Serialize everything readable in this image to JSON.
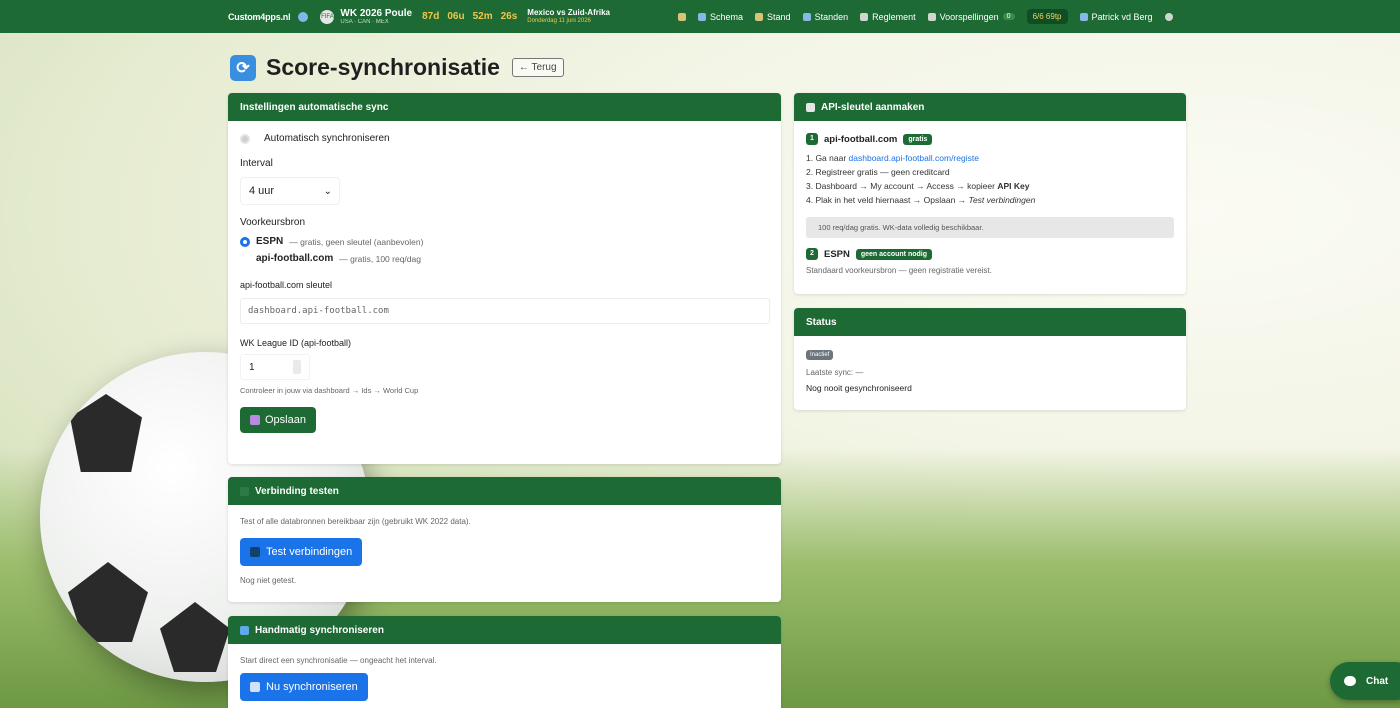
{
  "topbar": {
    "brand": "Custom4pps.nl",
    "poule_title": "WK 2026 Poule",
    "poule_sub": "USA · CAN · MEX",
    "poule_badge": "FIFA",
    "countdown": [
      "87d",
      "06u",
      "52m",
      "26s"
    ],
    "match_title": "Mexico vs Zuid-Afrika",
    "match_sub": "Donderdag 11 juni 2026",
    "nav": [
      {
        "label": "Schema"
      },
      {
        "label": "Stand"
      },
      {
        "label": "Standen"
      },
      {
        "label": "Reglement"
      },
      {
        "label": "Voorspellingen",
        "count": "0"
      }
    ],
    "points": "6/6 69tp",
    "user": "Patrick vd Berg"
  },
  "page": {
    "title": "Score-synchronisatie",
    "back_label": "← Terug"
  },
  "auto_sync": {
    "header": "Instellingen automatische sync",
    "toggle_label": "Automatisch synchroniseren",
    "interval_label": "Interval",
    "interval_value": "4 uur",
    "source_label": "Voorkeursbron",
    "sources": [
      {
        "name": "ESPN",
        "desc": "— gratis, geen sleutel (aanbevolen)"
      },
      {
        "name": "api-football.com",
        "desc": "— gratis, 100 req/dag"
      }
    ],
    "key_label": "api-football.com sleutel",
    "key_placeholder": "dashboard.api-football.com",
    "league_label": "WK League ID (api-football)",
    "league_value": "1",
    "league_help": "Controleer in jouw via dashboard → Ids → World Cup",
    "save_label": "Opslaan"
  },
  "test_conn": {
    "header": "Verbinding testen",
    "desc": "Test of alle databronnen bereikbaar zijn (gebruikt WK 2022 data).",
    "button": "Test verbindingen",
    "status": "Nog niet getest."
  },
  "manual_sync": {
    "header": "Handmatig synchroniseren",
    "desc": "Start direct een synchronisatie — ongeacht het interval.",
    "button": "Nu synchroniseren"
  },
  "api_key": {
    "header": "API-sleutel aanmaken",
    "step1_num": "1",
    "step1_title": "api-football.com",
    "step1_tag": "gratis",
    "steps": [
      {
        "prefix": "1. Ga naar ",
        "link": "dashboard.api-football.com/registe"
      },
      {
        "text": "2. Registreer gratis — geen creditcard"
      },
      {
        "text": "3. Dashboard → My account → Access → kopieer ",
        "bold": "API Key"
      },
      {
        "text": "4. Plak in het veld hiernaast → Opslaan → ",
        "italic": "Test verbindingen"
      }
    ],
    "note": "100 req/dag gratis. WK-data volledig beschikbaar.",
    "step2_num": "2",
    "step2_title": "ESPN",
    "step2_tag": "geen account nodig",
    "step2_desc": "Standaard voorkeursbron — geen registratie vereist."
  },
  "status": {
    "header": "Status",
    "badge": "Inactief",
    "last_sync": "Laatste sync: —",
    "state": "Nog nooit gesynchroniseerd"
  },
  "chat": {
    "label": "Chat"
  },
  "colors": {
    "primary": "#1d6a34",
    "blue": "#1a73e8"
  }
}
